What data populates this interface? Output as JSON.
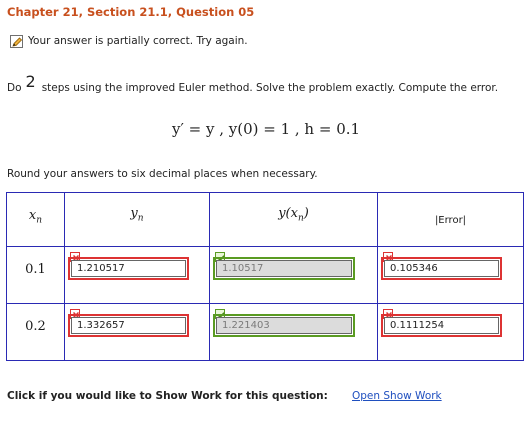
{
  "header": {
    "title": "Chapter 21, Section 21.1, Question 05"
  },
  "status": {
    "icon": "pencil-check-icon",
    "text": "Your answer is partially correct.  Try again."
  },
  "prompt": {
    "before": "Do",
    "n": "2",
    "after": "steps using the improved Euler method. Solve the problem exactly. Compute the error."
  },
  "equation": {
    "lhs": "y′ = y ,  y(0) = 1 ,  h = 0.1"
  },
  "round_note": "Round your answers to six decimal places when necessary.",
  "table": {
    "headers": {
      "xn": "x",
      "xn_sub": "n",
      "yn": "y",
      "yn_sub": "n",
      "yx": "y(x",
      "yx_sub": "n",
      "yx_end": ")",
      "err": "|Error|"
    },
    "rows": [
      {
        "x": "0.1",
        "yn": "1.210517",
        "yx": "1.10517",
        "err": "0.105346",
        "yn_state": "incorrect",
        "yx_state": "correct",
        "err_state": "incorrect"
      },
      {
        "x": "0.2",
        "yn": "1.332657",
        "yx": "1.221403",
        "err": "0.1111254",
        "yn_state": "incorrect",
        "yx_state": "correct",
        "err_state": "incorrect"
      }
    ]
  },
  "footer": {
    "text": "Click if you would like to Show Work for this question:",
    "link": "Open Show Work"
  }
}
